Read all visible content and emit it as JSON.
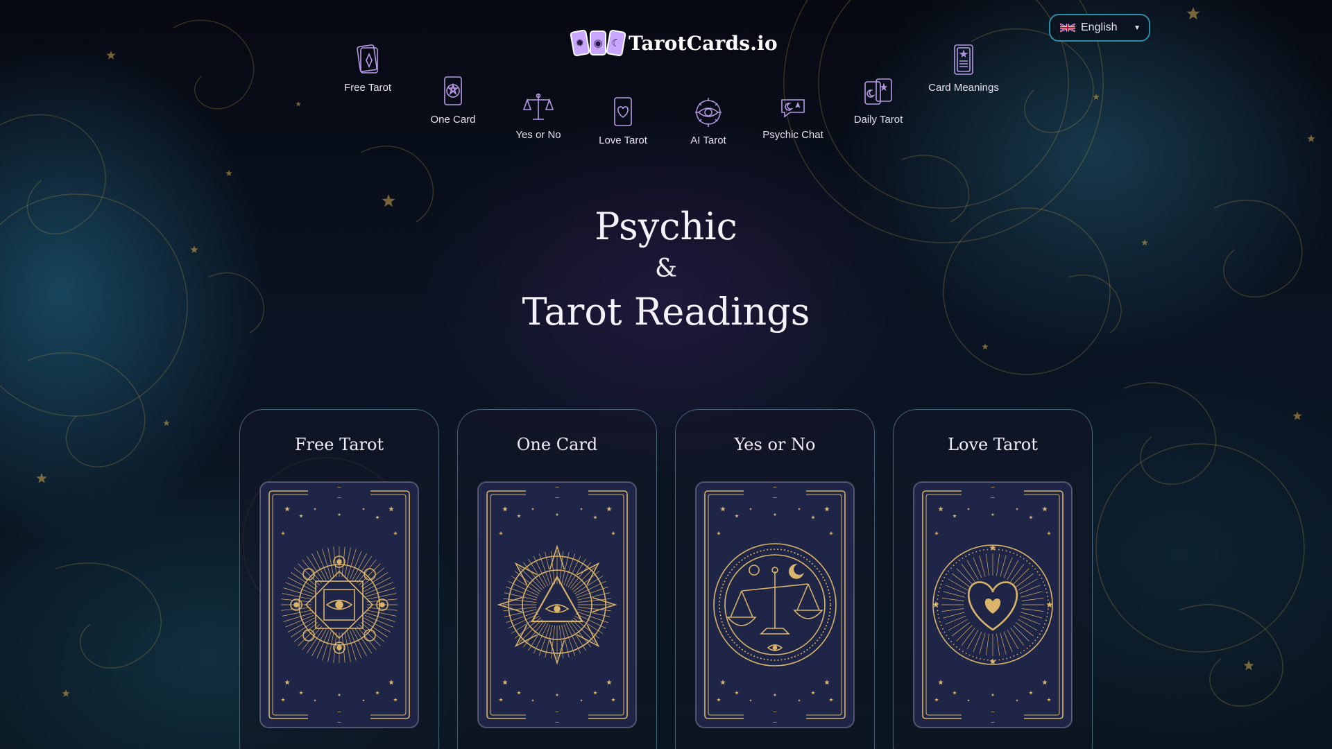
{
  "brand": {
    "name": "TarotCards.io",
    "logo_icons": [
      "sun-icon",
      "eye-icon",
      "moon-icon"
    ]
  },
  "language": {
    "selected": "English",
    "flag": "uk-flag-icon"
  },
  "nav": [
    {
      "label": "Free Tarot",
      "icon": "tarot-card-icon"
    },
    {
      "label": "One Card",
      "icon": "star-card-icon"
    },
    {
      "label": "Yes or No",
      "icon": "scales-icon"
    },
    {
      "label": "Love Tarot",
      "icon": "heart-card-icon"
    },
    {
      "label": "AI Tarot",
      "icon": "eye-icon"
    },
    {
      "label": "Psychic Chat",
      "icon": "chat-icon"
    },
    {
      "label": "Daily Tarot",
      "icon": "daily-cards-icon"
    },
    {
      "label": "Card Meanings",
      "icon": "book-icon"
    }
  ],
  "hero": {
    "line1": "Psychic",
    "amp": "&",
    "line2": "Tarot Readings"
  },
  "cards": [
    {
      "title": "Free Tarot",
      "art": "eye-mandala-icon"
    },
    {
      "title": "One Card",
      "art": "triangle-eye-sun-icon"
    },
    {
      "title": "Yes or No",
      "art": "scales-moon-icon"
    },
    {
      "title": "Love Tarot",
      "art": "heart-icon"
    }
  ],
  "colors": {
    "gold": "#d9b46a",
    "card_navy": "#1f2546",
    "nav_purple": "#b79be6",
    "teal_border": "#2c8ea3"
  }
}
